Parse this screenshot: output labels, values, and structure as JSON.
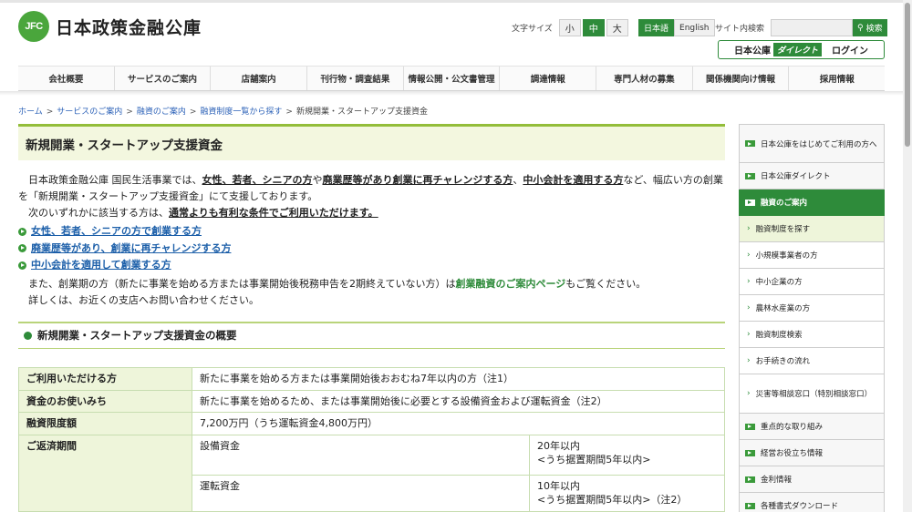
{
  "header": {
    "logo_mark": "JFC",
    "logo_text": "日本政策金融公庫",
    "font_size_label": "文字サイズ",
    "font_sizes": [
      "小",
      "中",
      "大"
    ],
    "font_size_selected": "中",
    "lang": [
      "日本語",
      "English"
    ],
    "lang_selected": "日本語",
    "search_label": "サイト内検索",
    "search_value": "",
    "search_button": "検索",
    "direct_prefix": "日本公庫",
    "direct_badge": "ダイレクト",
    "direct_login": "ログイン"
  },
  "nav": [
    "会社概要",
    "サービスのご案内",
    "店舗案内",
    "刊行物・調査結果",
    "情報公開・公文書管理",
    "調達情報",
    "専門人材の募集",
    "関係機関向け情報",
    "採用情報"
  ],
  "breadcrumb": {
    "links": [
      "ホーム",
      "サービスのご案内",
      "融資のご案内",
      "融資制度一覧から探す"
    ],
    "current": "新規開業・スタートアップ支援資金"
  },
  "main": {
    "title": "新規開業・スタートアップ支援資金",
    "intro": {
      "p1_a": "日本政策金融公庫 国民生活事業では、",
      "p1_b": "女性、若者、シニアの方",
      "p1_c": "や",
      "p1_d": "廃業歴等があり創業に再チャレンジする方",
      "p1_e": "、",
      "p1_f": "中小会計を適用する方",
      "p1_g": "など、幅広い方の創業を「新規開業・スタートアップ支援資金」にて支援しております。",
      "p2_a": "次のいずれかに該当する方は、",
      "p2_b": "通常よりも有利な条件でご利用いただけます。"
    },
    "links": [
      "女性、若者、シニアの方で創業する方",
      "廃業歴等があり、創業に再チャレンジする方",
      "中小会計を適用して創業する方"
    ],
    "also_a": "また、創業期の方（新たに事業を始める方または事業開始後税務申告を2期終えていない方）は",
    "also_link": "創業融資のご案内ページ",
    "also_b": "もご覧ください。",
    "also_c": "詳しくは、お近くの支店へお問い合わせください。",
    "section_title": "新規開業・スタートアップ支援資金の概要",
    "table": {
      "r1_h": "ご利用いただける方",
      "r1_v": "新たに事業を始める方または事業開始後おおむね7年以内の方（注1）",
      "r2_h": "資金のお使いみち",
      "r2_v": "新たに事業を始めるため、または事業開始後に必要とする設備資金および運転資金（注2）",
      "r3_h": "融資限度額",
      "r3_v": "7,200万円（うち運転資金4,800万円）",
      "r4_h": "ご返済期間",
      "r4_a_label": "設備資金",
      "r4_a_v1": "20年以内",
      "r4_a_v2": "<うち据置期間5年以内>",
      "r4_b_label": "運転資金",
      "r4_b_v1": "10年以内",
      "r4_b_v2": "<うち据置期間5年以内>（注2）"
    }
  },
  "sidebar": [
    {
      "label": "日本公庫をはじめてご利用の方へ",
      "type": "main"
    },
    {
      "label": "日本公庫ダイレクト",
      "type": "main"
    },
    {
      "label": "融資のご案内",
      "type": "active"
    },
    {
      "label": "融資制度を探す",
      "type": "subsel"
    },
    {
      "label": "小規模事業者の方",
      "type": "sub"
    },
    {
      "label": "中小企業の方",
      "type": "sub"
    },
    {
      "label": "農林水産業の方",
      "type": "sub"
    },
    {
      "label": "融資制度検索",
      "type": "sub"
    },
    {
      "label": "お手続きの流れ",
      "type": "sub"
    },
    {
      "label": "災害等相談窓口（特別相談窓口）",
      "type": "sub"
    },
    {
      "label": "重点的な取り組み",
      "type": "main"
    },
    {
      "label": "経営お役立ち情報",
      "type": "main"
    },
    {
      "label": "金利情報",
      "type": "main"
    },
    {
      "label": "各種書式ダウンロード",
      "type": "main"
    }
  ],
  "colors": {
    "brand_green": "#2e8b3a",
    "link_blue": "#1c5fa9",
    "heading_bg": "#f3f7df"
  }
}
